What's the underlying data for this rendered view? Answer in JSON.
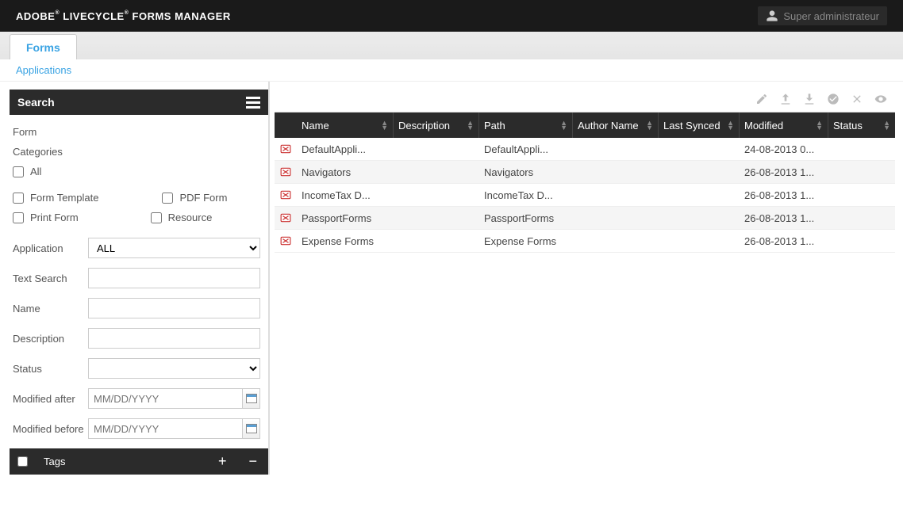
{
  "header": {
    "brand_pre": "ADOBE",
    "brand_mid": "LIVECYCLE",
    "brand_post": "FORMS MANAGER",
    "user_label": "Super administrateur"
  },
  "tabs": {
    "forms": "Forms"
  },
  "sublink": "Applications",
  "search": {
    "title": "Search",
    "form_label": "Form",
    "categories_label": "Categories",
    "all_label": "All",
    "form_template_label": "Form Template",
    "pdf_form_label": "PDF Form",
    "print_form_label": "Print Form",
    "resource_label": "Resource",
    "application_label": "Application",
    "application_value": "ALL",
    "text_search_label": "Text Search",
    "name_label": "Name",
    "description_label": "Description",
    "status_label": "Status",
    "modified_after_label": "Modified after",
    "modified_before_label": "Modified before",
    "date_placeholder": "MM/DD/YYYY",
    "tags_label": "Tags"
  },
  "grid": {
    "columns": {
      "name": "Name",
      "description": "Description",
      "path": "Path",
      "author": "Author Name",
      "sync": "Last Synced",
      "modified": "Modified",
      "status": "Status"
    },
    "rows": [
      {
        "name": "DefaultAppli...",
        "description": "",
        "path": "DefaultAppli...",
        "author": "",
        "sync": "",
        "modified": "24-08-2013 0...",
        "status": ""
      },
      {
        "name": "Navigators",
        "description": "",
        "path": "Navigators",
        "author": "",
        "sync": "",
        "modified": "26-08-2013 1...",
        "status": ""
      },
      {
        "name": "IncomeTax D...",
        "description": "",
        "path": "IncomeTax D...",
        "author": "",
        "sync": "",
        "modified": "26-08-2013 1...",
        "status": ""
      },
      {
        "name": "PassportForms",
        "description": "",
        "path": "PassportForms",
        "author": "",
        "sync": "",
        "modified": "26-08-2013 1...",
        "status": ""
      },
      {
        "name": "Expense Forms",
        "description": "",
        "path": "Expense Forms",
        "author": "",
        "sync": "",
        "modified": "26-08-2013 1...",
        "status": ""
      }
    ]
  }
}
